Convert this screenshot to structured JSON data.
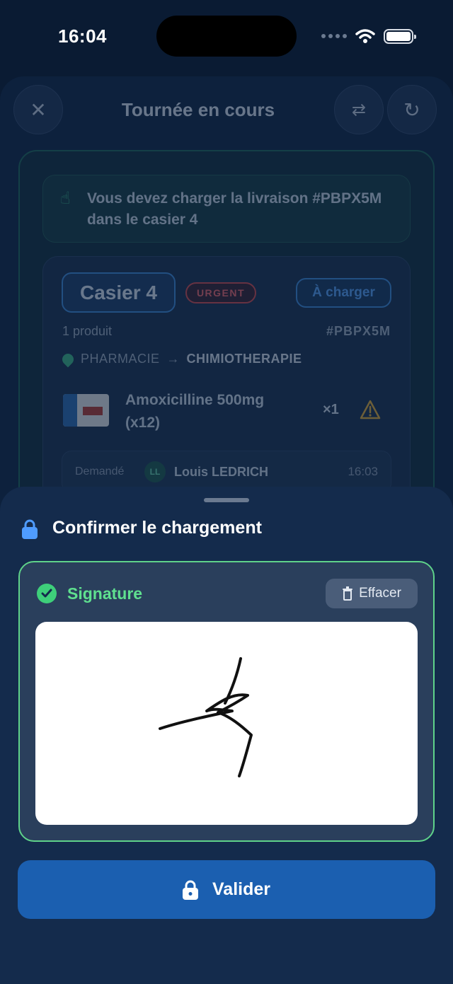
{
  "status_bar": {
    "time": "16:04",
    "icons": [
      "signal-dots-icon",
      "wifi-icon",
      "battery-icon"
    ]
  },
  "header": {
    "title": "Tournée en cours",
    "close_icon": "close-icon",
    "swap_icon": "swap-icon",
    "refresh_icon": "refresh-icon"
  },
  "instruction": {
    "icon": "tap-hand-icon",
    "text": "Vous devez charger la livraison #PBPX5M dans le casier 4"
  },
  "delivery": {
    "locker": "Casier 4",
    "urgency": "URGENT",
    "status": "À charger",
    "product_count": "1 produit",
    "order_id": "#PBPX5M",
    "origin": "PHARMACIE",
    "destination": "CHIMIOTHERAPIE",
    "product": {
      "name": "Amoxicilline 500mg (x12)",
      "quantity": "×1",
      "warning_icon": "warning-icon"
    },
    "requested": {
      "label": "Demandé",
      "initials": "LL",
      "name": "Louis LEDRICH",
      "time": "16:03"
    }
  },
  "modal": {
    "title": "Confirmer le chargement",
    "title_icon": "lock-icon",
    "signature": {
      "label": "Signature",
      "status_icon": "check-circle-icon",
      "clear_label": "Effacer",
      "clear_icon": "trash-icon"
    },
    "validate_label": "Valider",
    "validate_icon": "lock-icon"
  },
  "colors": {
    "background": "#0a1b33",
    "modal": "#142b4c",
    "accent_green": "#5fd38a",
    "accent_blue": "#1b5fb0",
    "urgent_red": "#e04b4b"
  }
}
